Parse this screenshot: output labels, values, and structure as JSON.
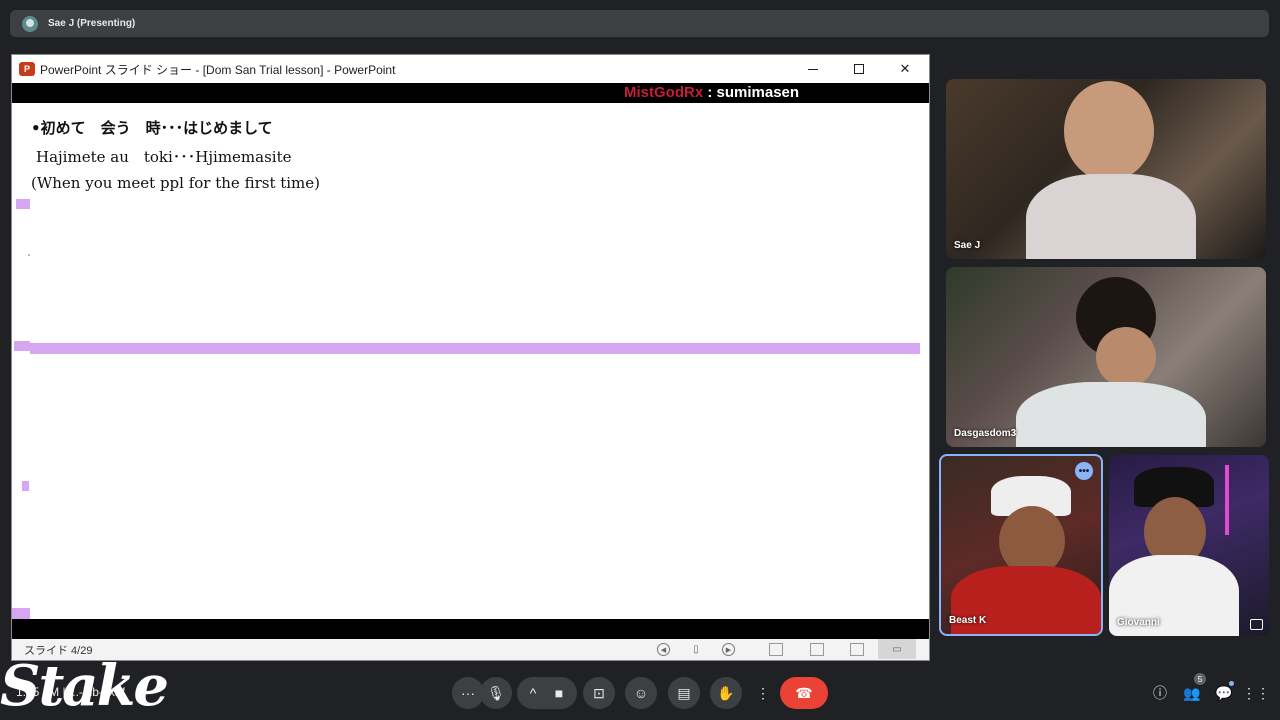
{
  "meet": {
    "presenter_label": "Sae J (Presenting)",
    "meeting_code_partial": "1:45 | M | ...-jnb-zxhf",
    "people_count": "5",
    "participants": [
      {
        "name": "Sae J"
      },
      {
        "name": "Dasgasdom3"
      },
      {
        "name": "Beast K"
      },
      {
        "name": "Giovanni"
      }
    ],
    "controls": {
      "more_options_icon": "ellipsis-icon",
      "mic_icon": "microphone-icon",
      "caret_icon": "caret-up-icon",
      "camera_icon": "camera-icon",
      "present_icon": "present-screen-icon",
      "emoji_icon": "emoji-icon",
      "captions_icon": "captions-icon",
      "hand_icon": "raise-hand-icon",
      "menu_icon": "kebab-icon",
      "end_call_icon": "end-call-icon"
    },
    "right_icons": [
      "info-icon",
      "people-icon",
      "chat-icon",
      "activities-icon"
    ],
    "accent_color": "#8ab4f8",
    "end_call_color": "#ea4335"
  },
  "ppt": {
    "window_title": "PowerPoint スライド ショー - [Dom San Trial lesson] - PowerPoint",
    "logo_letter": "P",
    "slide_counter": "スライド 4/29",
    "slide": {
      "line1": "•初めて　会う　時･･･はじめまして",
      "line2": "Hajimete au　toki･･･Hjimemasite",
      "line3": "(When you meet ppl for the first time)"
    },
    "highlight_color": "#d7a6f2"
  },
  "overlay": {
    "chat_user": "MistGodRx",
    "chat_message": " : sumimasen",
    "stake_logo": "Stake"
  }
}
